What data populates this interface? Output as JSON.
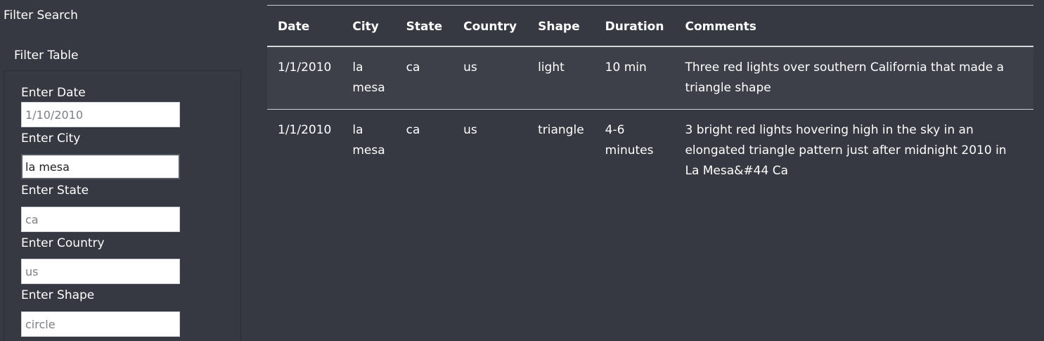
{
  "sidebar": {
    "search_title": "Filter Search",
    "table_title": "Filter Table",
    "fields": [
      {
        "label": "Enter Date",
        "value": "",
        "placeholder": "1/10/2010"
      },
      {
        "label": "Enter City",
        "value": "la mesa",
        "placeholder": ""
      },
      {
        "label": "Enter State",
        "value": "",
        "placeholder": "ca"
      },
      {
        "label": "Enter Country",
        "value": "",
        "placeholder": "us"
      },
      {
        "label": "Enter Shape",
        "value": "",
        "placeholder": "circle"
      }
    ]
  },
  "table": {
    "headers": [
      "Date",
      "City",
      "State",
      "Country",
      "Shape",
      "Duration",
      "Comments"
    ],
    "rows": [
      {
        "date": "1/1/2010",
        "city": "la mesa",
        "state": "ca",
        "country": "us",
        "shape": "light",
        "duration": "10 min",
        "comments": "Three red lights over southern California that made a triangle shape"
      },
      {
        "date": "1/1/2010",
        "city": "la mesa",
        "state": "ca",
        "country": "us",
        "shape": "triangle",
        "duration": "4-6 minutes",
        "comments": "3 bright red lights hovering high in the sky in an elongated triangle pattern just after midnight 2010 in La Mesa&#44 Ca"
      }
    ]
  },
  "colors": {
    "background": "#363941",
    "odd_row": "#3d4049",
    "text": "#ffffff"
  }
}
